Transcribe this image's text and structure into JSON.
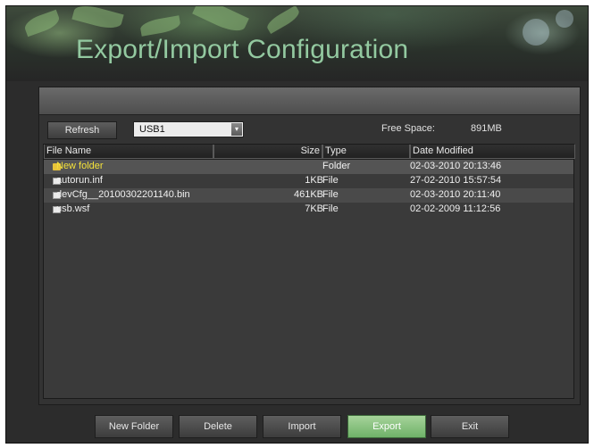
{
  "window": {
    "title": "Export/Import Configuration"
  },
  "toolbar": {
    "refresh_label": "Refresh",
    "device_select": {
      "value": "USB1",
      "arrow": "▾"
    },
    "free_space_label": "Free Space:",
    "free_space_value": "891MB"
  },
  "file_list": {
    "columns": [
      "File Name",
      "Size",
      "Type",
      "Date Modified"
    ],
    "rows": [
      {
        "name": "New folder",
        "size": "",
        "type": "Folder",
        "date": "02-03-2010 20:13:46",
        "icon": "folder-icon"
      },
      {
        "name": "autorun.inf",
        "size": "1KB",
        "type": "File",
        "date": "27-02-2010 15:57:54",
        "icon": "file-icon"
      },
      {
        "name": "devCfg__20100302201140.bin",
        "size": "461KB",
        "type": "File",
        "date": "02-03-2010 20:11:40",
        "icon": "file-icon"
      },
      {
        "name": "usb.wsf",
        "size": "7KB",
        "type": "File",
        "date": "02-02-2009 11:12:56",
        "icon": "file-icon"
      }
    ]
  },
  "buttons": {
    "new_folder": "New Folder",
    "delete": "Delete",
    "import": "Import",
    "export": "Export",
    "exit": "Exit"
  },
  "colors": {
    "title": "#93c9a0",
    "folder_text": "#f5e23a",
    "export_button": "#8cc482"
  }
}
